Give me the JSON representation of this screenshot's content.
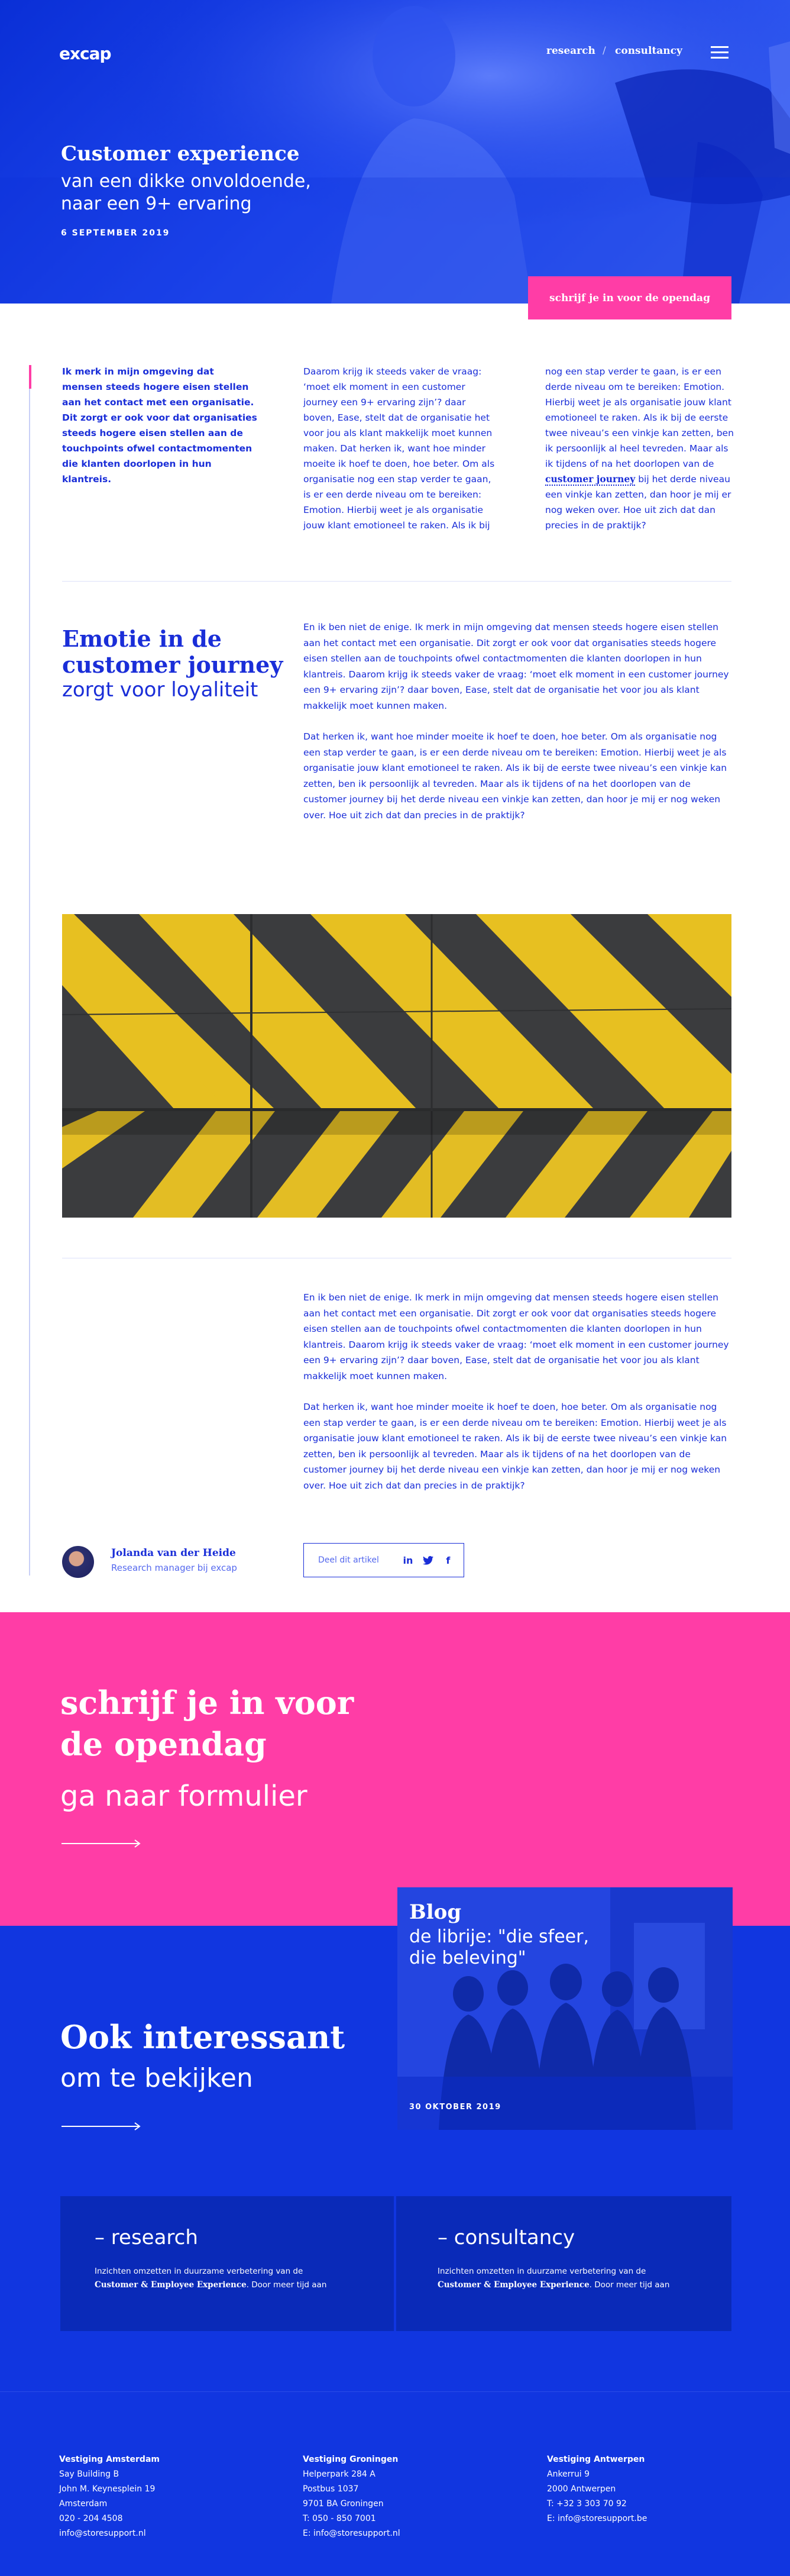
{
  "header": {
    "logo": "excap",
    "nav": {
      "research": "research",
      "separator": "/",
      "consultancy": "consultancy"
    },
    "menu_icon": "hamburger-menu-icon"
  },
  "hero": {
    "title": "Customer experience",
    "subtitle_line1": "van een dikke onvoldoende,",
    "subtitle_line2": "naar een 9+ ervaring",
    "date": "6 SEPTEMBER 2019",
    "signup_button": "schrijf je in voor de opendag"
  },
  "intro": {
    "col1": "Ik merk in mijn omgeving dat mensen steeds hogere eisen stellen aan het contact met een organisatie. Dit zorgt er ook voor dat organisaties steeds hogere eisen stellen aan de touchpoints ofwel contactmomenten die klanten doorlopen in hun klantreis.",
    "col2": "Daarom krijg ik steeds vaker de vraag: ‘moet elk moment in een customer journey een 9+ ervaring zijn’? daar boven, Ease, stelt dat de organisatie het voor jou als klant makkelijk moet kunnen maken. Dat herken ik, want hoe minder moeite ik hoef te doen, hoe beter. Om als organisatie nog een stap verder te gaan, is er een derde niveau om te bereiken: Emotion. Hierbij weet je als organisatie jouw klant emotioneel te raken. Als ik bij",
    "col3_before": " nog een stap verder te gaan, is er een derde niveau om te bereiken: Emotion. Hierbij weet je als organisatie jouw klant emotioneel te raken. Als ik bij de eerste twee niveau’s een vinkje kan zetten, ben ik persoonlijk al  heel tevreden. Maar als ik tijdens of na het doorlopen van de ",
    "col3_link": "customer journey",
    "col3_after": " bij het derde niveau een vinkje kan zetten, dan hoor je mij er nog weken over. Hoe uit zich dat dan precies in de praktijk?"
  },
  "section_emotie": {
    "title_line1": "Emotie in de",
    "title_line2": "customer journey",
    "subtitle": "zorgt voor loyaliteit",
    "p1": "En ik ben niet de enige. Ik merk in mijn omgeving dat mensen steeds hogere eisen stellen aan het contact met een organisatie. Dit zorgt er ook voor dat organisaties steeds hogere eisen stellen aan de touchpoints ofwel contactmomenten die klanten doorlopen in hun klantreis. Daarom krijg ik steeds vaker de vraag: ‘moet elk moment in een customer journey een 9+ ervaring zijn’? daar boven, Ease, stelt dat de organisatie het voor jou als klant makkelijk moet kunnen maken.",
    "p2": " Dat herken ik, want hoe minder moeite ik hoef te doen, hoe beter. Om als organisatie nog een stap verder te gaan, is er een derde niveau om te bereiken: Emotion. Hierbij weet je als organisatie jouw klant emotioneel te raken. Als ik bij de eerste twee niveau’s een vinkje kan zetten, ben ik persoonlijk al tevreden. Maar als ik tijdens of na het doorlopen van de customer journey bij het derde niveau een vinkje kan zetten, dan hoor je mij er nog weken over. Hoe uit zich dat dan precies in de praktijk?"
  },
  "section_after_image": {
    "p1": "En ik ben niet de enige. Ik merk in mijn omgeving dat mensen steeds hogere eisen stellen aan het contact met een organisatie. Dit zorgt er ook voor dat organisaties steeds hogere eisen stellen aan de touchpoints ofwel contactmomenten die klanten doorlopen in hun klantreis. Daarom krijg ik steeds vaker de vraag: ‘moet elk moment in een customer journey een 9+ ervaring zijn’? daar boven, Ease, stelt dat de organisatie het voor jou als klant makkelijk moet kunnen maken.",
    "p2": " Dat herken ik, want hoe minder moeite ik hoef te doen, hoe beter. Om als organisatie nog een stap verder te gaan, is er een derde niveau om te bereiken: Emotion. Hierbij weet je als organisatie jouw klant emotioneel te raken. Als ik bij de eerste twee niveau’s een vinkje kan zetten, ben ik persoonlijk al tevreden. Maar als ik tijdens of na het doorlopen van de customer journey bij het derde niveau een vinkje kan zetten, dan hoor je mij er nog weken over. Hoe uit zich dat dan precies in de praktijk?"
  },
  "author": {
    "name": "Jolanda van der Heide",
    "role": "Research manager bij excap"
  },
  "share": {
    "label": "Deel dit artikel",
    "icons": [
      "linkedin-icon",
      "twitter-icon",
      "facebook-icon"
    ]
  },
  "cta": {
    "title_line1": "schrijf je in voor",
    "title_line2": "de opendag",
    "subtitle": "ga naar formulier"
  },
  "related": {
    "title": "Ook interessant",
    "subtitle": "om te bekijken",
    "blog": {
      "label": "Blog",
      "title_line1": "de librije: \"die sfeer,",
      "title_line2": "die beleving\"",
      "date": "30 OKTOBER 2019"
    }
  },
  "services": [
    {
      "title": "– research",
      "text_before": "Inzichten omzetten in duurzame verbetering van de",
      "text_bold": "Customer & Employee Experience",
      "text_after": ". Door meer tijd aan"
    },
    {
      "title": "– consultancy",
      "text_before": "Inzichten omzetten in duurzame verbetering van de",
      "text_bold": "Customer & Employee Experience",
      "text_after": ". Door meer tijd aan"
    }
  ],
  "footer": [
    {
      "heading": "Vestiging Amsterdam",
      "lines": [
        "Say Building B",
        "John M. Keynesplein 19",
        "Amsterdam",
        "020 - 204 4508",
        "info@storesupport.nl"
      ]
    },
    {
      "heading": "Vestiging Groningen",
      "lines": [
        "Helperpark 284 A",
        "Postbus 1037",
        "9701 BA Groningen",
        "T: 050 - 850 7001",
        "E: info@storesupport.nl"
      ]
    },
    {
      "heading": "Vestiging Antwerpen",
      "lines": [
        "Ankerrui 9",
        "2000 Antwerpen",
        "T: +32 3 303 70 92",
        "E: info@storesupport.be"
      ]
    }
  ],
  "colors": {
    "primary_blue": "#1136e0",
    "accent_pink": "#ff3da6",
    "text_blue": "#1a2ed8"
  }
}
